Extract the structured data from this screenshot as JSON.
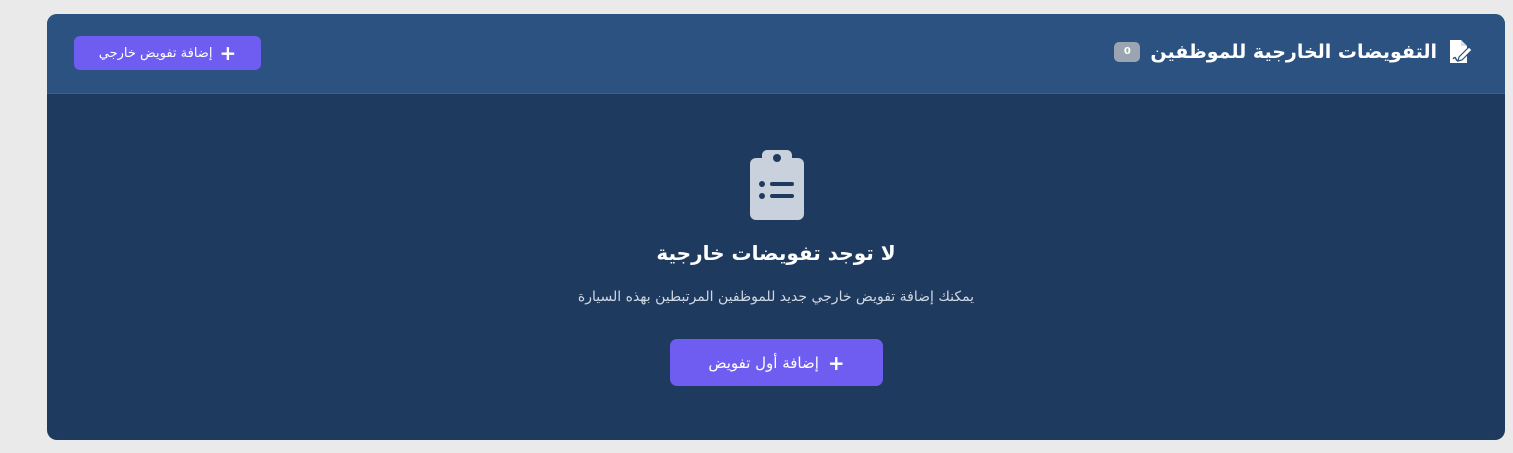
{
  "header": {
    "title": "التفويضات الخارجية للموظفين",
    "count": "0",
    "icon": "file-signature-icon",
    "add_button_label": "إضافة تفويض خارجي",
    "add_button_icon": "plus-icon"
  },
  "empty_state": {
    "icon": "clipboard-list-icon",
    "title": "لا توجد تفويضات خارجية",
    "description": "يمكنك إضافة تفويض خارجي جديد للموظفين المرتبطين بهذه السيارة",
    "add_first_label": "إضافة أول تفويض",
    "add_first_icon": "plus-icon"
  },
  "colors": {
    "header_bg": "#2c5282",
    "body_bg": "#1f3a5f",
    "accent": "#6f5cf0",
    "badge_bg": "#9aa5b1",
    "page_bg": "#eaeaea"
  }
}
